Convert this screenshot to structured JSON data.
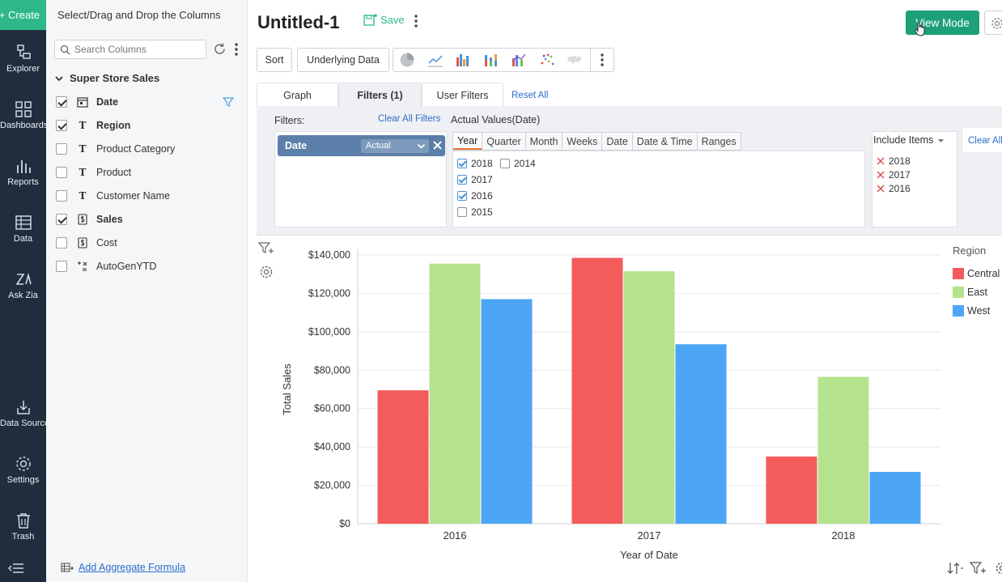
{
  "nav": {
    "create_label": "+ Create",
    "items": [
      {
        "label": "Explorer",
        "icon": "explorer-icon"
      },
      {
        "label": "Dashboards",
        "icon": "dashboards-icon"
      },
      {
        "label": "Reports",
        "icon": "reports-icon"
      },
      {
        "label": "Data",
        "icon": "data-icon"
      },
      {
        "label": "Ask Zia",
        "icon": "ask-zia-icon"
      },
      {
        "label": "Data Sources",
        "icon": "data-sources-icon"
      },
      {
        "label": "Settings",
        "icon": "settings-icon"
      },
      {
        "label": "Trash",
        "icon": "trash-icon"
      }
    ]
  },
  "columns_panel": {
    "title": "Select/Drag and Drop the Columns",
    "search_placeholder": "Search Columns",
    "table_name": "Super Store Sales",
    "columns": [
      {
        "label": "Date",
        "checked": true,
        "type": "date"
      },
      {
        "label": "Region",
        "checked": true,
        "type": "text"
      },
      {
        "label": "Product Category",
        "checked": false,
        "type": "text"
      },
      {
        "label": "Product",
        "checked": false,
        "type": "text"
      },
      {
        "label": "Customer Name",
        "checked": false,
        "type": "text"
      },
      {
        "label": "Sales",
        "checked": true,
        "type": "currency"
      },
      {
        "label": "Cost",
        "checked": false,
        "type": "currency"
      },
      {
        "label": "AutoGenYTD",
        "checked": false,
        "type": "formula"
      }
    ],
    "add_aggregate_label": "Add Aggregate Formula"
  },
  "header": {
    "title": "Untitled-1",
    "save_label": "Save",
    "view_mode_label": "View Mode"
  },
  "toolbar": {
    "sort_label": "Sort",
    "underlying_data_label": "Underlying Data"
  },
  "tabs": [
    {
      "label": "Graph",
      "active": false
    },
    {
      "label": "Filters (1)",
      "active": true
    },
    {
      "label": "User Filters",
      "active": false
    }
  ],
  "reset_all_label": "Reset All",
  "filters": {
    "label": "Filters:",
    "clear_all_filters_label": "Clear All Filters",
    "pill_label": "Date",
    "pill_value": "Actual",
    "actual_values_title": "Actual Values(Date)",
    "date_tabs": [
      "Year",
      "Quarter",
      "Month",
      "Weeks",
      "Date",
      "Date & Time",
      "Ranges"
    ],
    "active_date_tab": "Year",
    "values": [
      {
        "label": "2018",
        "checked": true
      },
      {
        "label": "2017",
        "checked": true
      },
      {
        "label": "2016",
        "checked": true
      },
      {
        "label": "2015",
        "checked": false
      },
      {
        "label": "2014",
        "checked": false
      }
    ],
    "include_label": "Include Items",
    "included": [
      "2018",
      "2017",
      "2016"
    ],
    "clear_all_label": "Clear All"
  },
  "colors": {
    "accent": "#2eb88a",
    "view_mode": "#1da07a",
    "link": "#2d6ec9"
  },
  "chart_data": {
    "type": "bar",
    "categories": [
      "2016",
      "2017",
      "2018"
    ],
    "series": [
      {
        "name": "Central",
        "color": "#f45b5b",
        "values": [
          69500,
          138500,
          35000
        ]
      },
      {
        "name": "East",
        "color": "#b5e38d",
        "values": [
          135500,
          131500,
          76500
        ]
      },
      {
        "name": "West",
        "color": "#4da6f5",
        "values": [
          117000,
          93500,
          27000
        ]
      }
    ],
    "xlabel": "Year of Date",
    "ylabel": "Total Sales",
    "legend_title": "Region",
    "legend_position": "right",
    "ylim": [
      0,
      140000
    ],
    "yticks": [
      "$0",
      "$20,000",
      "$40,000",
      "$60,000",
      "$80,000",
      "$100,000",
      "$120,000",
      "$140,000"
    ],
    "grid": true
  }
}
